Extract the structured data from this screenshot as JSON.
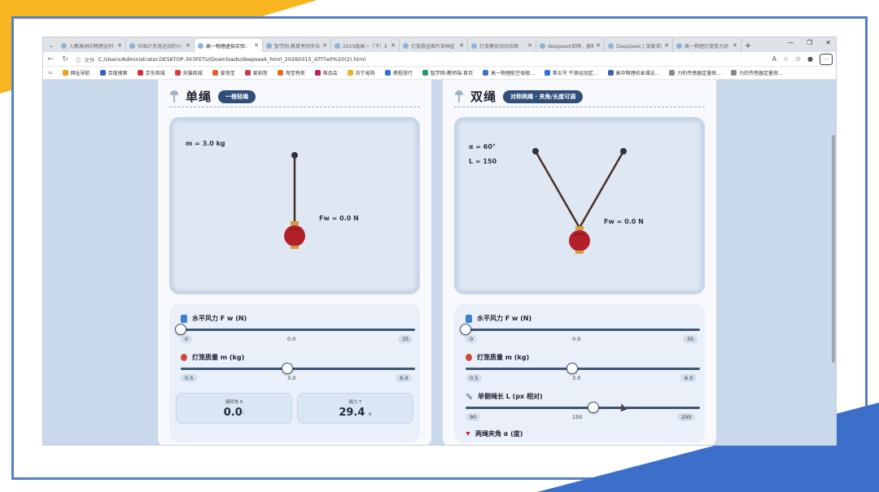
{
  "browser": {
    "tabs": [
      {
        "label": "入教高闻中物理运列",
        "active": false
      },
      {
        "label": "中国计天涯运动的小",
        "active": false
      },
      {
        "label": "高一物理虚拟实验：",
        "active": true
      },
      {
        "label": "智学网-教育考同步乐",
        "active": false
      },
      {
        "label": "2025级高一（下）E",
        "active": false
      },
      {
        "label": "灯笼悬挂图片各种征",
        "active": false
      },
      {
        "label": "灯笼模页动动去图",
        "active": false
      },
      {
        "label": "deepseek官网 - 搜索",
        "active": false
      },
      {
        "label": "DeepSeek | 深度求索",
        "active": false
      },
      {
        "label": "高一物理灯笼受力动",
        "active": false
      }
    ],
    "url_prefix": "文件",
    "url": "C:/Users/Administrator.DESKTOP-303FETU/Downloads/deepseek_html_20260315_d7f7e0%20(2).html",
    "bookmarks": [
      "网址导航",
      "百度搜索",
      "京东商城",
      "天猫商城",
      "爱淘宝",
      "爱刻菲",
      "淘宝特卖",
      "唯品会",
      "苏宁易购",
      "携程旅行",
      "智学网-教师端-首页",
      "高一物理航空母舰...",
      "第五节 牛顿运动定...",
      "高中物理校本课设...",
      "力的传感器定量探...",
      "力的传感器定量探..."
    ]
  },
  "single": {
    "title": "单绳",
    "badge": "一根轻绳",
    "mass_readout": "m = 3.0 kg",
    "force_readout": "Fw = 0.0 N",
    "wind_label": "水平风力 F w (N)",
    "wind_min": "0",
    "wind_value": "0.0",
    "wind_max": "35",
    "wind_fraction": 0.0,
    "mass_label": "灯笼质量 m (kg)",
    "mass_min": "0.5",
    "mass_value": "3.0",
    "mass_max": "6.0",
    "mass_fraction": 0.4545,
    "angle_label": "偏转角 θ",
    "angle_value": "0.0",
    "angle_unit": "°",
    "tension_label": "绳力 T",
    "tension_value": "29.4",
    "tension_unit": "N"
  },
  "double": {
    "title": "双绳",
    "badge": "对称两绳 · 夹角/长度可调",
    "alpha_readout": "α = 60°",
    "length_readout": "L = 150",
    "force_readout": "Fw = 0.0 N",
    "wind_label": "水平风力 F w (N)",
    "wind_min": "0",
    "wind_value": "0.0",
    "wind_max": "35",
    "wind_fraction": 0.0,
    "mass_label": "灯笼质量 m (kg)",
    "mass_min": "0.5",
    "mass_value": "3.0",
    "mass_max": "6.0",
    "mass_fraction": 0.4545,
    "length_label": "单侧绳长 L (px 相对)",
    "length_min": "90",
    "length_value": "150",
    "length_max": "200",
    "length_fraction": 0.5455,
    "alpha_label": "两绳夹角 α (度)"
  },
  "colors": {
    "lantern": "#b3202a",
    "rope": "#4a3024",
    "badge": "#2f4f7a",
    "track": "#3d5674"
  }
}
